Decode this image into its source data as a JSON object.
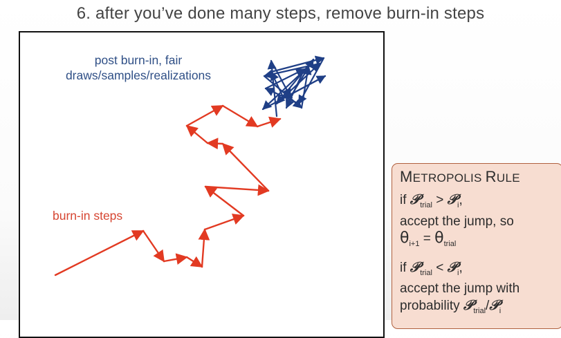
{
  "slide": {
    "title": "6. after you’ve done many steps, remove burn-in steps"
  },
  "diagram": {
    "post_burn_label_line1": "post burn-in, fair",
    "post_burn_label_line2": "draws/samples/realizations",
    "burn_in_label": "burn-in steps",
    "burn_in_color": "#e23a22",
    "post_burn_color": "#1f3f86"
  },
  "rule_box": {
    "title_first": "M",
    "title_rest": "ETROPOLIS ",
    "title_second": "R",
    "title_second_rest": "ULE",
    "case1_prefix": "if ",
    "symbol": "𝒫",
    "sub_trial": "trial",
    "sub_i": "i",
    "greater": " > ",
    "less": " < ",
    "comma": ",",
    "case1_action": "accept the jump, so",
    "theta": "θ",
    "sub_i_plus_1": "i+1",
    "equals": " = ",
    "case2_prefix": "if ",
    "case2_action": "accept the jump with",
    "probability_word": "probability ",
    "slash": "/"
  }
}
